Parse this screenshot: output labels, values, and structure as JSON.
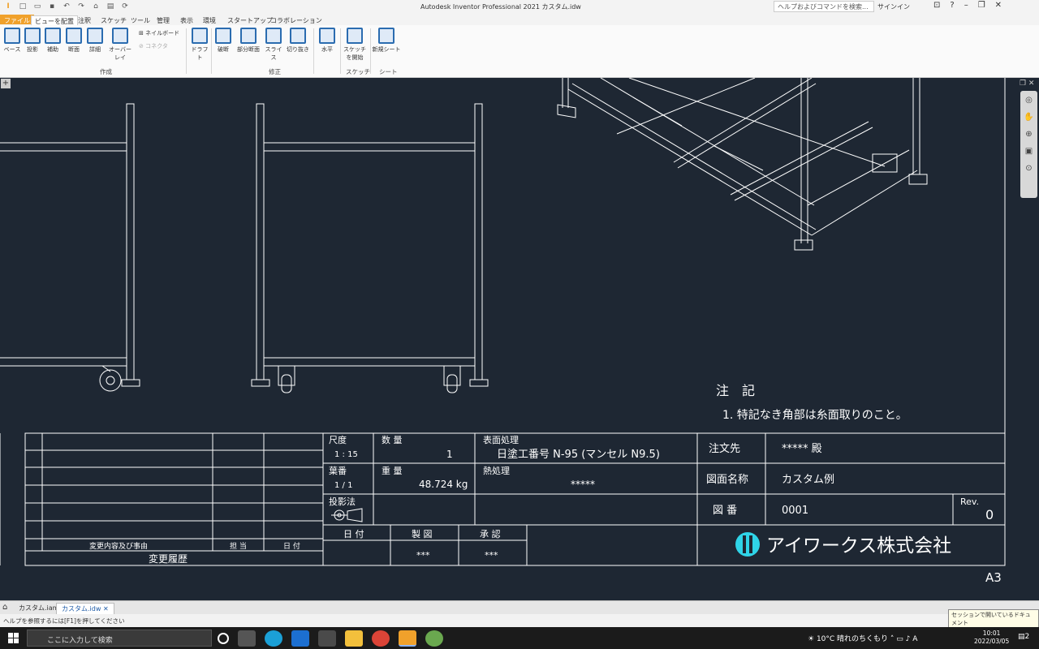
{
  "window": {
    "title": "Autodesk Inventor Professional 2021  カスタム.idw",
    "search_placeholder": "ヘルプおよびコマンドを検索...",
    "signin": "サインイン"
  },
  "tabs": [
    "ファイル",
    "ビューを配置",
    "注釈",
    "スケッチ",
    "ツール",
    "管理",
    "表示",
    "環境",
    "スタートアップ",
    "コラボレーション"
  ],
  "ribbon": {
    "buttons": [
      "ベース",
      "投影",
      "補助",
      "断面",
      "詳細",
      "オーバーレイ",
      "ドラフト",
      "破断",
      "部分断面",
      "スライス",
      "切り抜き",
      "水平",
      "スケッチを開始",
      "新規シート"
    ],
    "small_buttons": [
      "ネイルボード",
      "コネクタ"
    ],
    "groups": [
      "作成",
      "修正",
      "スケッチ",
      "シート"
    ]
  },
  "drawing": {
    "notes_title": "注　記",
    "notes_item": "1.  特記なき角部は糸面取りのこと。",
    "sheet_size": "A3",
    "revision_table": {
      "footer_labels": [
        "変更内容及び事由",
        "担 当",
        "日 付"
      ],
      "title": "変更履歴"
    },
    "title_block": {
      "scale_label": "尺度",
      "scale": "1 : 15",
      "qty_label": "数 量",
      "qty": "1",
      "surface_label": "表面処理",
      "surface": "日塗工番号 N-95 (マンセル N9.5)",
      "sheet_label": "葉番",
      "sheet": "1 / 1",
      "weight_label": "重 量",
      "weight": "48.724 kg",
      "heat_label": "熱処理",
      "heat": "*****",
      "projection_label": "投影法",
      "date_label": "日 付",
      "drawn_label": "製 図",
      "approved_label": "承 認",
      "drawn": "***",
      "approved": "***",
      "customer_label": "注文先",
      "customer": "***** 殿",
      "drawing_name_label": "図面名称",
      "drawing_name": "カスタム例",
      "drawing_no_label": "図 番",
      "drawing_no": "0001",
      "rev_label": "Rev.",
      "rev": "0",
      "company": "アイワークス株式会社"
    }
  },
  "documents": [
    "カスタム.iam",
    "カスタム.idw"
  ],
  "status_text": "ヘルプを参照するには[F1]を押してください",
  "tooltip": "セッションで開いているドキュメント",
  "taskbar": {
    "search_placeholder": "ここに入力して検索",
    "weather": "10°C  晴れのちくもり",
    "time": "10:01",
    "date": "2022/03/05",
    "notifications": "2"
  }
}
